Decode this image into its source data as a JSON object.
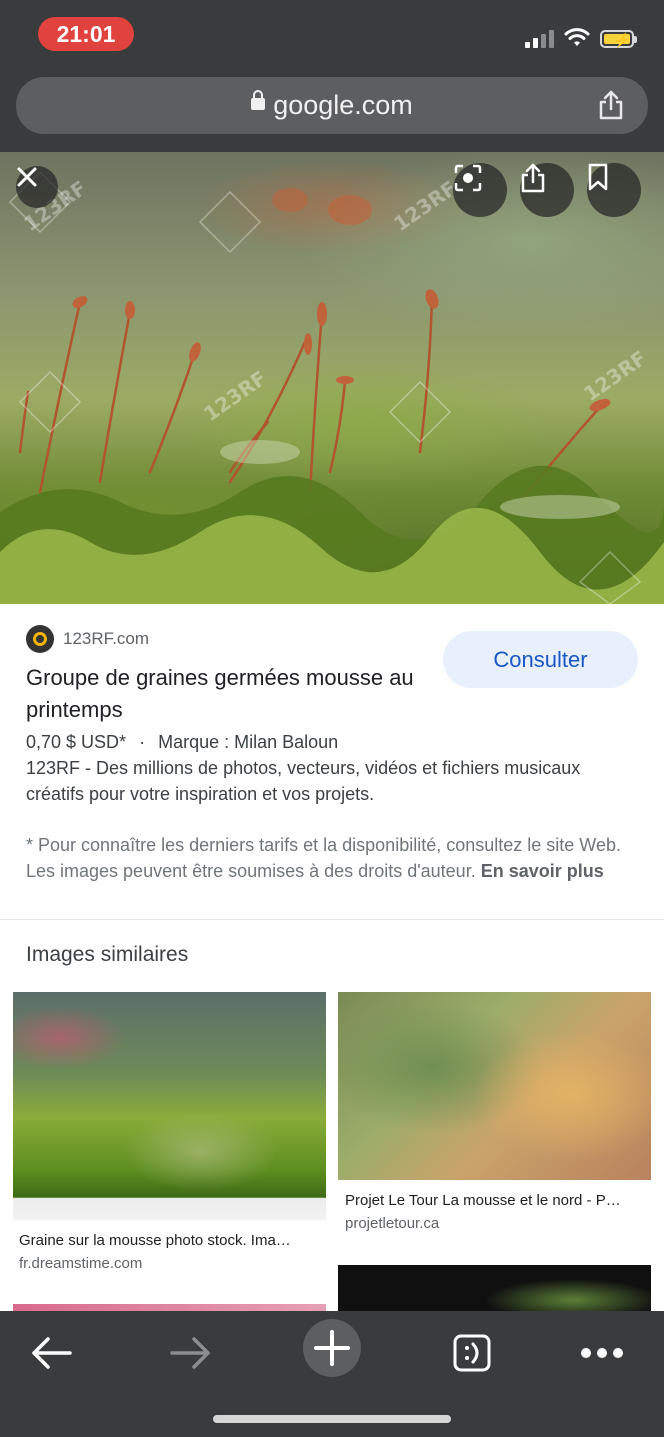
{
  "status": {
    "time": "21:01"
  },
  "browser": {
    "url": "google.com",
    "icons": [
      "lock-icon",
      "share-icon"
    ]
  },
  "hero": {
    "watermark": "123RF",
    "buttons": [
      "close-icon",
      "lens-icon",
      "share-icon",
      "bookmark-icon"
    ]
  },
  "result": {
    "source": "123RF.com",
    "consult_label": "Consulter",
    "title": "Groupe de graines germées mousse au printemps",
    "price": "0,70 $ USD*",
    "separator": "·",
    "brand": "Marque : Milan Baloun",
    "description": "123RF - Des millions de photos, vecteurs, vidéos et fichiers musicaux créatifs pour votre inspiration et vos projets.",
    "disclaimer": "* Pour connaître les derniers tarifs et la disponibilité, consultez le site Web. Les images peuvent être soumises à des droits d'auteur.",
    "learn_more": "En savoir plus"
  },
  "similar": {
    "title": "Images similaires",
    "items": [
      {
        "caption": "Graine sur la mousse photo stock. Ima…",
        "domain": "fr.dreamstime.com"
      },
      {
        "caption": "Projet Le Tour La mousse et le nord - P…",
        "domain": "projetletour.ca"
      }
    ]
  },
  "toolbar": {
    "icons": [
      "back-arrow-icon",
      "forward-arrow-icon",
      "new-tab-plus-icon",
      "tab-switcher-icon",
      "more-menu-icon"
    ]
  }
}
